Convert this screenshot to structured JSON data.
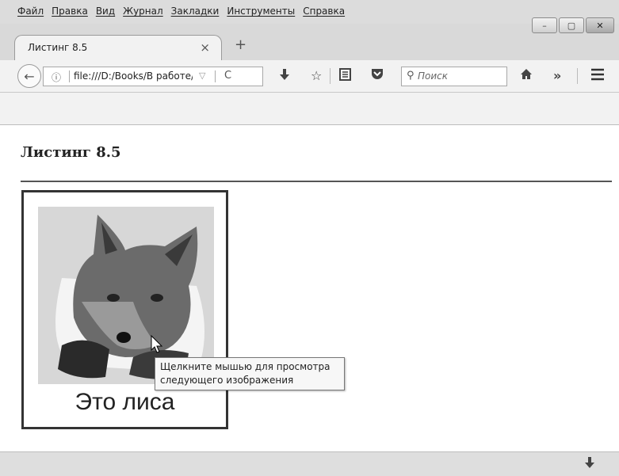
{
  "menu": [
    "Файл",
    "Правка",
    "Вид",
    "Журнал",
    "Закладки",
    "Инструменты",
    "Справка"
  ],
  "window_buttons": {
    "minimize": "–",
    "maximize": "▢",
    "close": "✕"
  },
  "tab": {
    "title": "Листинг 8.5",
    "close": "×",
    "new_tab": "+"
  },
  "nav": {
    "back": "←",
    "url": "file:///D:/Books/В работе/",
    "url_dropdown": "▽",
    "reload": "C",
    "search_placeholder": "Поиск",
    "icons": [
      "download-icon",
      "star-icon",
      "reading-list-icon",
      "pocket-icon",
      "home-icon",
      "overflow-icon",
      "menu-icon"
    ]
  },
  "page": {
    "heading": "Листинг 8.5",
    "caption": "Это лиса",
    "tooltip_line1": "Щелкните мышью для просмотра",
    "tooltip_line2": "следующего изображения"
  }
}
